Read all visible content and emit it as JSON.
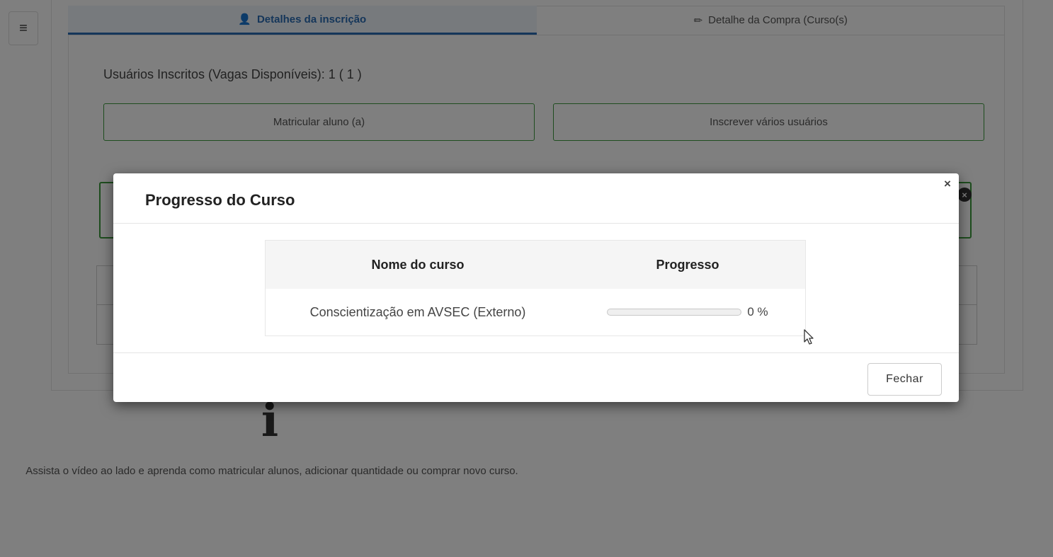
{
  "menu": {
    "icon": "hamburger-menu-icon",
    "glyph": "≡"
  },
  "tabs": [
    {
      "label": "Detalhes da inscrição",
      "icon": "user-icon",
      "glyph": "👤",
      "active": true
    },
    {
      "label": "Detalhe da Compra (Curso(s)",
      "icon": "pencil-icon",
      "glyph": "✏",
      "active": false
    }
  ],
  "enrollment": {
    "summary": "Usuários Inscritos (Vagas Disponíveis): 1 ( 1 )",
    "enroll_button": "Matricular aluno (a)",
    "bulk_button": "Inscrever vários usuários"
  },
  "alert": {
    "close_glyph": "×"
  },
  "info": {
    "icon": "info-icon",
    "glyph": "i",
    "text": "Assista o vídeo ao lado e aprenda como matricular alunos, adicionar quantidade ou comprar novo curso."
  },
  "modal": {
    "title": "Progresso do Curso",
    "close_glyph": "×",
    "table": {
      "headers": [
        "Nome do curso",
        "Progresso"
      ],
      "rows": [
        {
          "course": "Conscientização em AVSEC (Externo)",
          "progress": 0,
          "progress_label": "0 %"
        }
      ]
    },
    "footer_button": "Fechar"
  },
  "colors": {
    "accent": "#2a6db5",
    "success_border": "#3c9a3c"
  }
}
